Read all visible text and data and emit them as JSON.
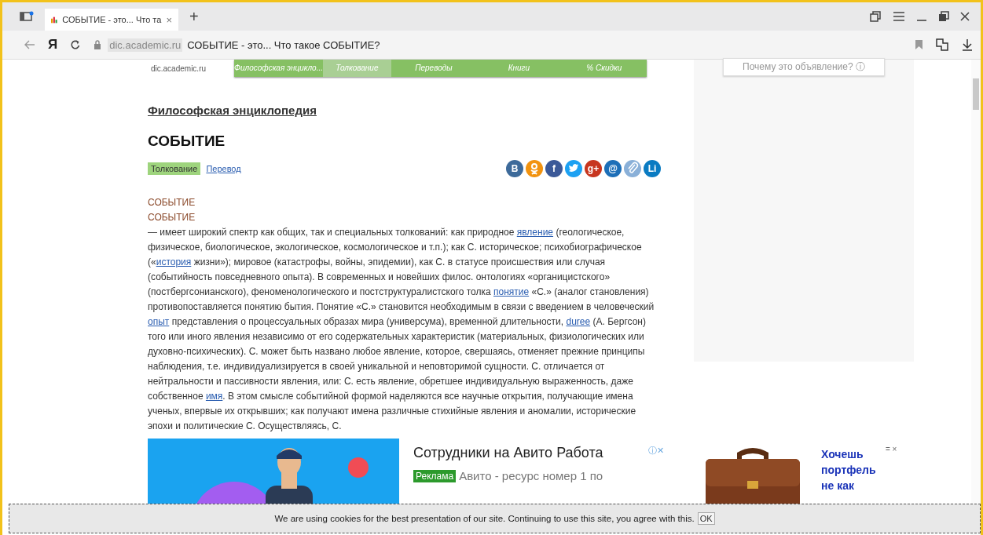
{
  "browser": {
    "tab": {
      "title": "СОБЫТИЕ - это... Что та",
      "close": "×"
    },
    "new_tab": "+",
    "logo": "Я",
    "domain": "dic.academic.ru",
    "page_title": "СОБЫТИЕ - это... Что такое СОБЫТИЕ?"
  },
  "site": {
    "domain": "dic.academic.ru",
    "nav": [
      {
        "label": "Философская энцикло...",
        "selected": false
      },
      {
        "label": "Толкование",
        "selected": true
      },
      {
        "label": "Переводы",
        "selected": false
      },
      {
        "label": "Книги",
        "selected": false
      },
      {
        "label": "% Скидки",
        "selected": false
      }
    ]
  },
  "dictionary": "Философская энциклопедия",
  "title": "СОБЫТИЕ",
  "modes": [
    {
      "label": "Толкование",
      "selected": true
    },
    {
      "label": "Перевод",
      "selected": false
    }
  ],
  "share": [
    {
      "kind": "letter",
      "glyph": "B",
      "color": "#3d6a9a"
    },
    {
      "kind": "ok",
      "color": "#f2930f"
    },
    {
      "kind": "letter",
      "glyph": "f",
      "color": "#3b5998"
    },
    {
      "kind": "bird",
      "color": "#1da1f2"
    },
    {
      "kind": "letter",
      "glyph": "g+",
      "color": "#c7361f"
    },
    {
      "kind": "letter",
      "glyph": "@",
      "color": "#1d6fb8"
    },
    {
      "kind": "clip",
      "color": "#8ab0d8"
    },
    {
      "kind": "letter",
      "glyph": "Li",
      "color": "#0a7bc2"
    }
  ],
  "headwords": [
    "СОБЫТИЕ",
    "СОБЫТИЕ"
  ],
  "article": [
    {
      "kind": "text",
      "text": "— имеет широкий спектр как общих, так и специальных толкований: как природное "
    },
    {
      "kind": "link",
      "text": "явление"
    },
    {
      "kind": "text",
      "text": " (геологическое, физическое, биологическое, экологическое, космологическое и т.п.); как С. историческое; психобиографическое («"
    },
    {
      "kind": "link",
      "text": "история"
    },
    {
      "kind": "text",
      "text": " жизни»); мировое (катастрофы, войны, эпидемии), как С. в статусе происшествия или случая (событийность повседневного опыта). В современных и новейших филос. онтологиях «органицистского» (постбергсонианского), феноменологического и постструктуралистского толка "
    },
    {
      "kind": "link",
      "text": "понятие"
    },
    {
      "kind": "text",
      "text": " «С.» (аналог становления) противопоставляется понятию бытия. Понятие «С.» становится необходимым в связи с введением в человеческий "
    },
    {
      "kind": "link",
      "text": "опыт"
    },
    {
      "kind": "text",
      "text": " представления о процессуальных образах мира (универсума), временной длительности, "
    },
    {
      "kind": "link",
      "text": "duree"
    },
    {
      "kind": "text",
      "text": " (А. Бергсон) того или иного явления независимо от его содержательных характеристик (материальных, физиологических или духовно-психических). С. может быть названо любое явление, которое, свершаясь, отменяет прежние принципы наблюдения, т.е. индивидуализируется в своей уникальной и неповторимой сущности. С. отличается от нейтральности и пассивности явления, или: С. есть явление, обретшее индивидуальную выраженность, даже собственное "
    },
    {
      "kind": "link",
      "text": "имя"
    },
    {
      "kind": "text",
      "text": ". В этом смысле событийной формой наделяются все научные открытия, получающие имена ученых, впервые их открывших; как получают имена различные стихийные явления и аномалии, исторические эпохи и политические С. Осуществляясь, С."
    }
  ],
  "sidebar_ad": {
    "why": "Почему это объявление? ⓘ"
  },
  "ad": {
    "kind": "picture",
    "headline": "Сотрудники на Авито Работа",
    "controls": "ⓘ✕",
    "badge": "Реклама",
    "text": "Авито - ресурс номер 1 по"
  },
  "ad_right": {
    "kind": "picture",
    "text": "Хочешь портфель не как",
    "controls": "= ×"
  },
  "cookie": {
    "text": "We are using cookies for the best presentation of our site. Continuing to use this site, you agree with this.",
    "button": "OK"
  }
}
